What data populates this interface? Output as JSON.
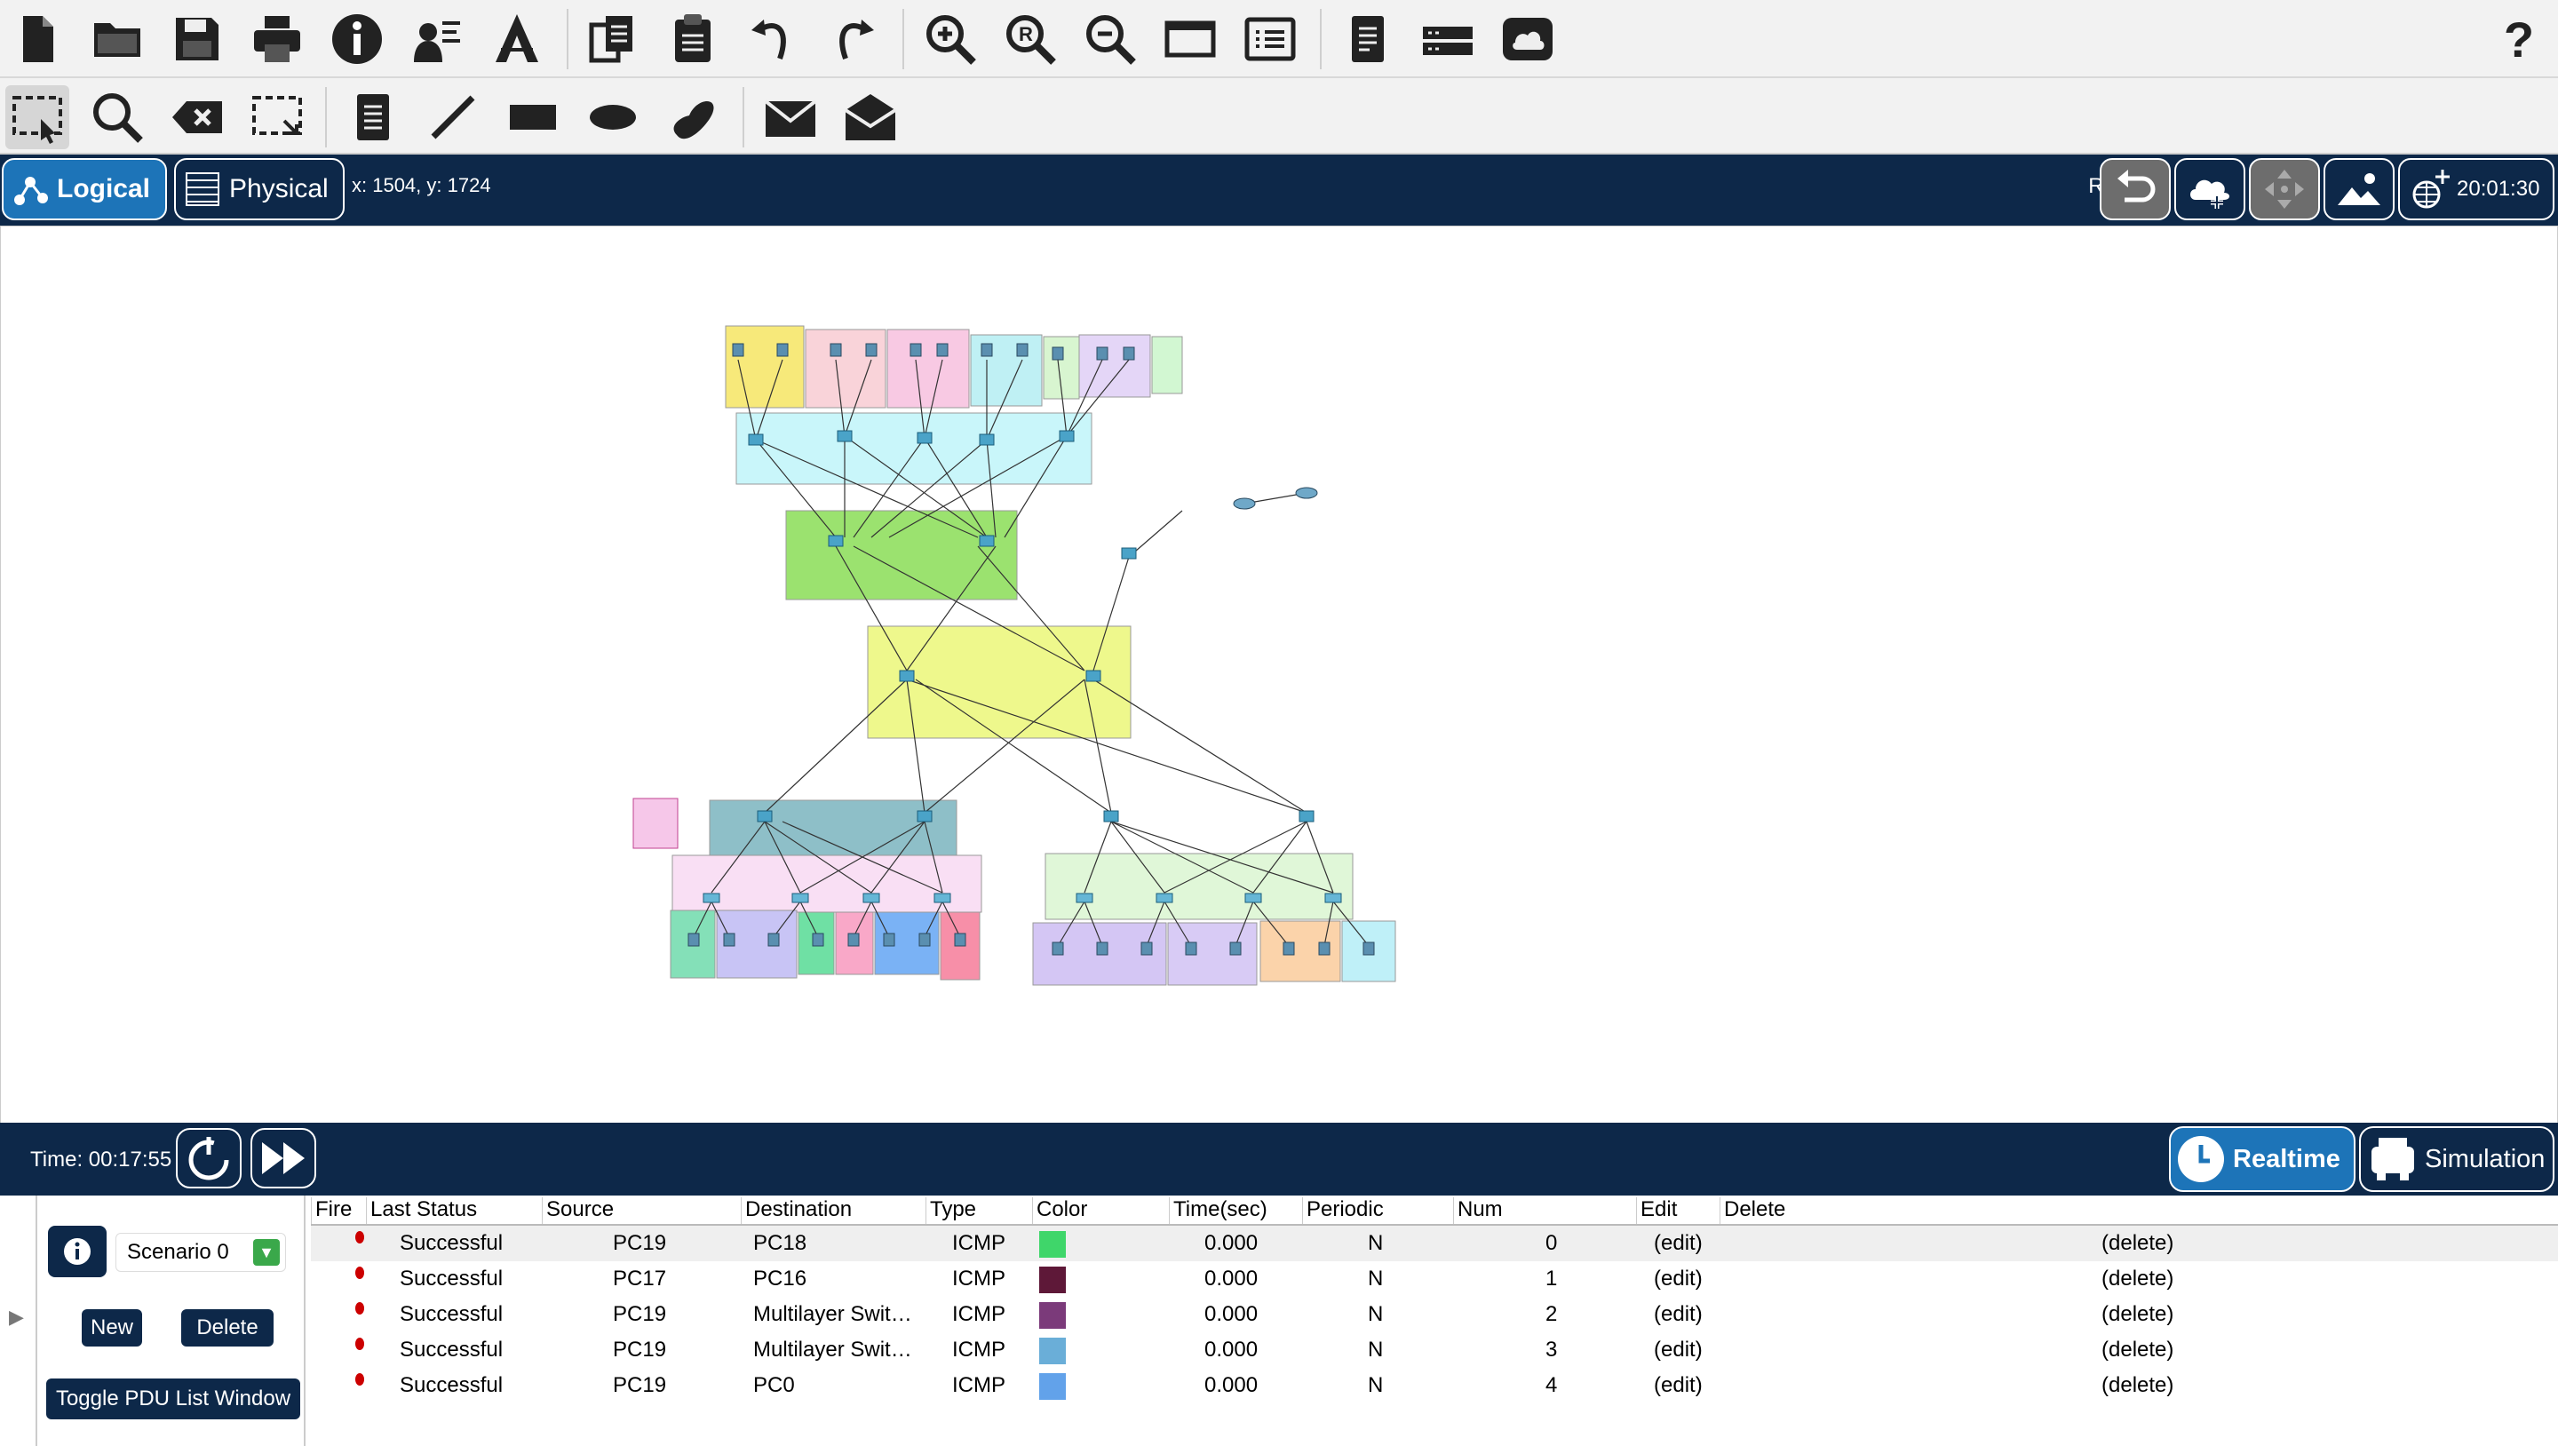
{
  "toolbar1": {
    "icons": [
      "new-file-icon",
      "open-folder-icon",
      "save-icon",
      "print-icon",
      "info-icon",
      "activity-wizard-icon",
      "custom-device-icon",
      "copy-icon",
      "paste-icon",
      "undo-icon",
      "redo-icon",
      "zoom-in-icon",
      "zoom-reset-icon",
      "zoom-out-icon",
      "drawing-palette-icon",
      "custom-devices-dialog-icon",
      "document-icon",
      "network-device-icon",
      "pt-cloud-icon",
      "help-icon"
    ],
    "help": "?"
  },
  "toolbar2": {
    "icons": [
      "select-icon",
      "inspect-icon",
      "delete-icon",
      "resize-shape-icon",
      "place-note-icon",
      "draw-line-icon",
      "draw-rectangle-icon",
      "draw-ellipse-icon",
      "draw-freeform-icon",
      "add-simple-pdu-icon",
      "add-complex-pdu-icon"
    ]
  },
  "modebar": {
    "logical": "Logical",
    "physical": "Physical",
    "coords": "x: 1504, y: 1724",
    "root": "Root",
    "clock": "20:01:30"
  },
  "timebar": {
    "time": "Time: 00:17:55",
    "realtime": "Realtime",
    "simulation": "Simulation"
  },
  "pdu_panel": {
    "scenario": "Scenario 0",
    "new": "New",
    "delete": "Delete",
    "toggle": "Toggle PDU List Window",
    "columns": [
      "Fire",
      "Last Status",
      "Source",
      "Destination",
      "Type",
      "Color",
      "Time(sec)",
      "Periodic",
      "Num",
      "Edit",
      "Delete"
    ],
    "rows": [
      {
        "status": "Successful",
        "source": "PC19",
        "destination": "PC18",
        "type": "ICMP",
        "color": "#3fd66a",
        "time": "0.000",
        "periodic": "N",
        "num": "0",
        "edit": "(edit)",
        "delete": "(delete)"
      },
      {
        "status": "Successful",
        "source": "PC17",
        "destination": "PC16",
        "type": "ICMP",
        "color": "#5e1838",
        "time": "0.000",
        "periodic": "N",
        "num": "1",
        "edit": "(edit)",
        "delete": "(delete)"
      },
      {
        "status": "Successful",
        "source": "PC19",
        "destination": "Multilayer Swit…",
        "type": "ICMP",
        "color": "#7b3a7a",
        "time": "0.000",
        "periodic": "N",
        "num": "2",
        "edit": "(edit)",
        "delete": "(delete)"
      },
      {
        "status": "Successful",
        "source": "PC19",
        "destination": "Multilayer Swit…",
        "type": "ICMP",
        "color": "#6aaed8",
        "time": "0.000",
        "periodic": "N",
        "num": "3",
        "edit": "(edit)",
        "delete": "(delete)"
      },
      {
        "status": "Successful",
        "source": "PC19",
        "destination": "PC0",
        "type": "ICMP",
        "color": "#62a2ea",
        "time": "0.000",
        "periodic": "N",
        "num": "4",
        "edit": "(edit)",
        "delete": "(delete)"
      }
    ]
  }
}
